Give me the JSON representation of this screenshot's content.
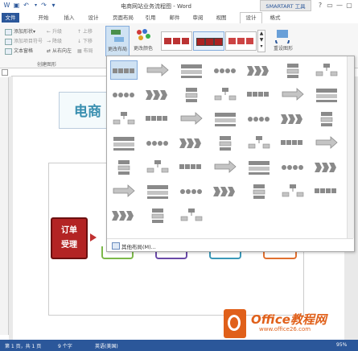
{
  "window": {
    "title": "电商网站业务流程图 - Word",
    "contextual_tab": "SMARTART 工具",
    "controls": [
      "?",
      "▭",
      "—",
      "▢",
      "✕"
    ]
  },
  "qat": {
    "save_icon": "save-icon",
    "undo_icon": "undo-icon",
    "redo_icon": "redo-icon"
  },
  "tabs": [
    "文件",
    "开始",
    "插入",
    "设计",
    "页面布局",
    "引用",
    "邮件",
    "审阅",
    "视图",
    "设计",
    "格式"
  ],
  "ribbon": {
    "create_graphic": {
      "items": [
        {
          "label": "添加形状",
          "arrow": "▾",
          "enabled": true
        },
        {
          "label": "添加项目符号",
          "enabled": false
        },
        {
          "label": "文本窗格",
          "enabled": true
        },
        {
          "label": "升级",
          "enabled": false
        },
        {
          "label": "降级",
          "enabled": false
        },
        {
          "label": "从右向左",
          "enabled": true
        },
        {
          "label": "上移",
          "enabled": false
        },
        {
          "label": "下移",
          "enabled": false
        },
        {
          "label": "布局",
          "enabled": false
        }
      ],
      "group_label": "创建图形"
    },
    "change_layout": {
      "label": "更改布局"
    },
    "change_colors": {
      "label": "更改颜色"
    },
    "reset_graphic": {
      "label": "重设图形"
    }
  },
  "document": {
    "header_text": "电商",
    "order_box": {
      "line1": "订单",
      "line2": "受理"
    }
  },
  "gallery": {
    "more_layouts": "其他布局(M)..."
  },
  "status": {
    "page": "第 1 页，共 1 页",
    "words": "9 个字",
    "language": "英语(美国)",
    "zoom": "95%"
  },
  "watermark": {
    "text": "Office教程网",
    "sub": "www.office26.com"
  },
  "colors": {
    "accent": "#2b579a",
    "order_red": "#b32424",
    "watermark_orange": "#e0601a"
  }
}
